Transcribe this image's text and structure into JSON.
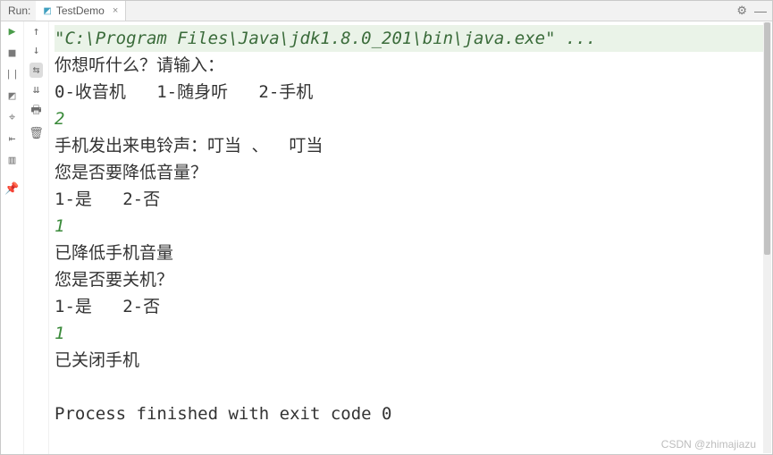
{
  "titlebar": {
    "label": "Run:",
    "tab": "TestDemo"
  },
  "toolbar_left": {
    "play": "▶",
    "stop": "■",
    "pause": "❘❘",
    "camera": "◩",
    "debug": "⌖",
    "exit": "⇤",
    "layout": "▥",
    "pin": "📌"
  },
  "toolbar_side": {
    "up": "↑",
    "down": "↓",
    "wrap": "⇆",
    "scroll": "⇊",
    "print": "🖶",
    "trash": "🗑"
  },
  "titlebar_right": {
    "gear": "⚙",
    "hide": "—"
  },
  "console": {
    "command": "\"C:\\Program Files\\Java\\jdk1.8.0_201\\bin\\java.exe\" ...",
    "lines": [
      "你想听什么？请输入：",
      "0-收音机   1-随身听   2-手机",
      {
        "input": "2"
      },
      "手机发出来电铃声：叮当 、  叮当",
      "您是否要降低音量？",
      "1-是   2-否",
      {
        "input": "1"
      },
      "已降低手机音量",
      "您是否要关机？",
      "1-是   2-否",
      {
        "input": "1"
      },
      "已关闭手机",
      {
        "blank": true
      },
      {
        "exit": "Process finished with exit code 0"
      }
    ]
  },
  "watermark": "CSDN @zhimajiazu"
}
